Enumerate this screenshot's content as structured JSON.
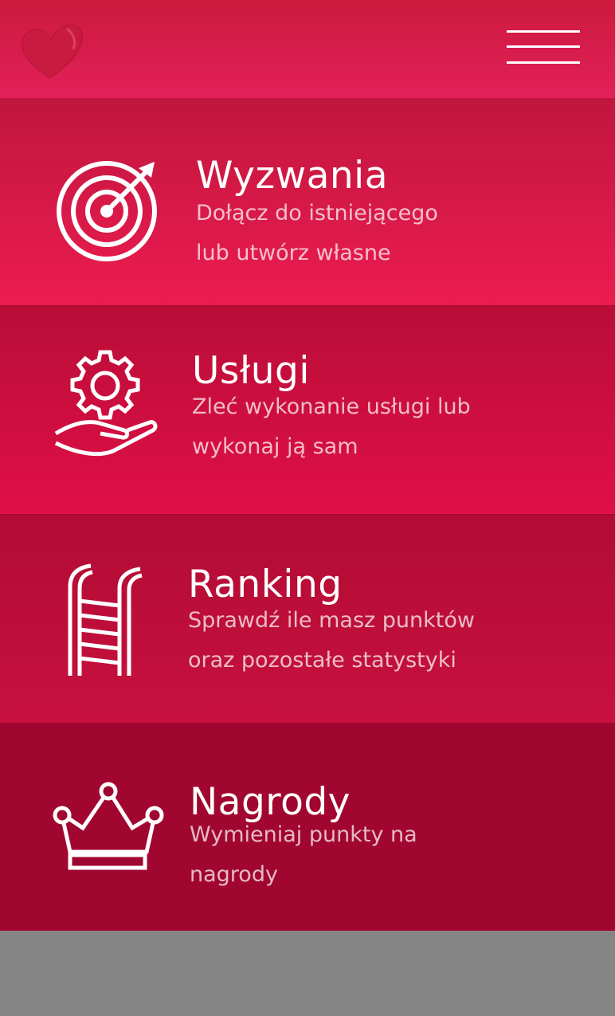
{
  "header": {
    "logo_icon": "heart-logo-icon",
    "menu_icon": "hamburger-menu-icon"
  },
  "tiles": [
    {
      "icon": "target-icon",
      "title": "Wyzwania",
      "subtitle_line1": "Dołącz do istniejącego",
      "subtitle_line2": "lub utwórz własne"
    },
    {
      "icon": "gear-hand-icon",
      "title": "Usługi",
      "subtitle_line1": "Zleć wykonanie usługi lub",
      "subtitle_line2": "wykonaj ją sam"
    },
    {
      "icon": "ladder-icon",
      "title": "Ranking",
      "subtitle_line1": "Sprawdź ile masz punktów",
      "subtitle_line2": "oraz pozostałe statystyki"
    },
    {
      "icon": "crown-icon",
      "title": "Nagrody",
      "subtitle_line1": "Wymieniaj punkty na",
      "subtitle_line2": "nagrody"
    }
  ],
  "colors": {
    "header": "#d81e4a",
    "tile_challenges": "#e01a4c",
    "tile_services": "#d40f44",
    "tile_ranking": "#c10f3b",
    "tile_rewards": "#a10630",
    "footer": "#858585"
  }
}
